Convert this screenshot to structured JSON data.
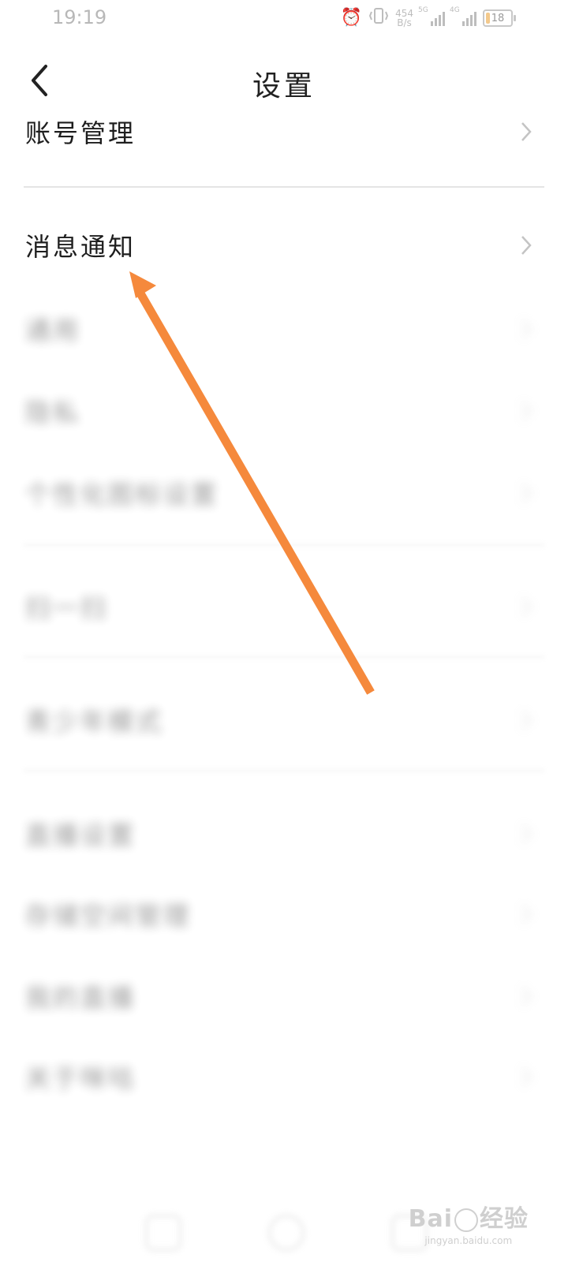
{
  "status_bar": {
    "time": "19:19",
    "net_speed_value": "454",
    "net_speed_unit": "B/s",
    "sim1_tag": "5G",
    "sim2_tag": "4G",
    "battery_level": "18",
    "battery_fraction": 0.18,
    "icons": [
      "alarm-icon",
      "vibrate-icon"
    ]
  },
  "nav": {
    "title": "设置",
    "back_icon": "chevron-left-icon"
  },
  "settings": {
    "items": [
      {
        "label": "账号管理"
      },
      {
        "label": "消息通知"
      },
      {
        "label": "通用"
      },
      {
        "label": "隐私"
      },
      {
        "label": "个性化图标设置"
      },
      {
        "label": "扫一扫"
      },
      {
        "label": "青少年模式"
      },
      {
        "label": "直播设置"
      },
      {
        "label": "存储空间管理"
      },
      {
        "label": "我的直播"
      },
      {
        "label": "关于咪咕"
      }
    ]
  },
  "annotation": {
    "color": "#f5893c"
  },
  "watermark": {
    "brand": "Bai",
    "brand_suffix": "经验",
    "url": "jingyan.baidu.com"
  }
}
